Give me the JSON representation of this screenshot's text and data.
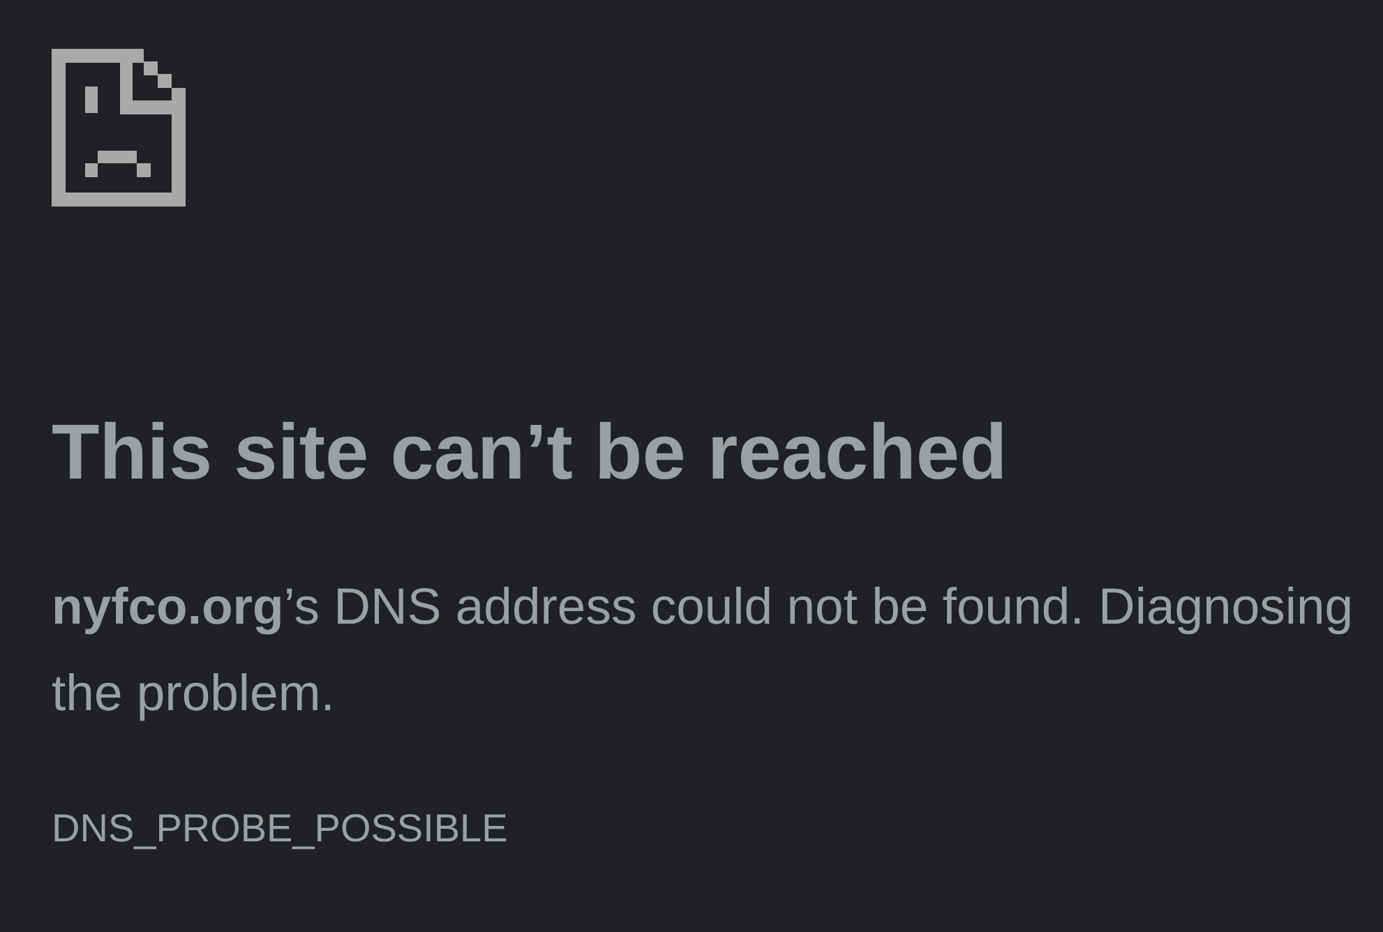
{
  "error_page": {
    "heading": "This site can’t be reached",
    "message": "**nyfco.org**’s DNS address could not be found. Diagnosing the problem.",
    "error_code": "DNS_PROBE_POSSIBLE"
  }
}
